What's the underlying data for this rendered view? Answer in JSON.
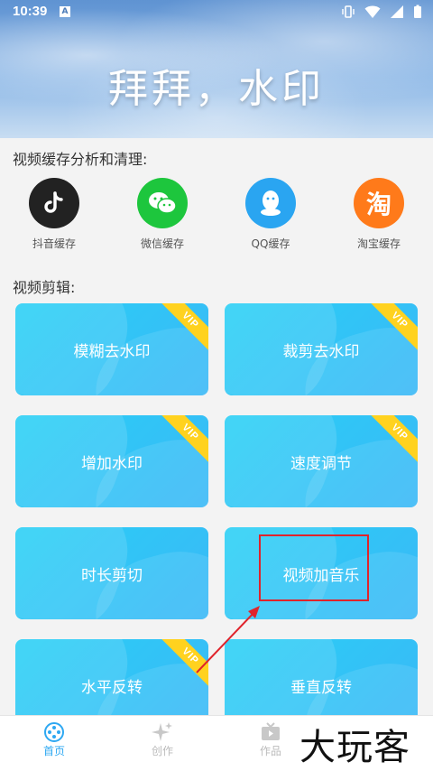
{
  "status_bar": {
    "time": "10:39",
    "app_badge": "A"
  },
  "banner": {
    "title": "拜拜，水印"
  },
  "cache_section": {
    "title": "视频缓存分析和清理:",
    "items": [
      {
        "label": "抖音缓存",
        "icon": "tiktok-icon",
        "color": "#222222"
      },
      {
        "label": "微信缓存",
        "icon": "wechat-icon",
        "color": "#1dc63d"
      },
      {
        "label": "QQ缓存",
        "icon": "qq-icon",
        "color": "#2aa5f1"
      },
      {
        "label": "淘宝缓存",
        "icon": "taobao-icon",
        "color": "#ff7a1a",
        "glyph": "淘"
      }
    ]
  },
  "edit_section": {
    "title": "视频剪辑:",
    "tiles": [
      {
        "label": "模糊去水印",
        "vip": true
      },
      {
        "label": "裁剪去水印",
        "vip": true
      },
      {
        "label": "增加水印",
        "vip": true
      },
      {
        "label": "速度调节",
        "vip": true
      },
      {
        "label": "时长剪切",
        "vip": false
      },
      {
        "label": "视频加音乐",
        "vip": false
      },
      {
        "label": "水平反转",
        "vip": true
      },
      {
        "label": "垂直反转",
        "vip": false
      }
    ],
    "vip_label": "VIP"
  },
  "bottom_nav": {
    "items": [
      {
        "label": "首页",
        "active": true
      },
      {
        "label": "创作",
        "active": false
      },
      {
        "label": "作品",
        "active": false
      }
    ]
  },
  "overlay": {
    "watermark": "大玩客"
  },
  "colors": {
    "accent": "#2ea8f2",
    "tile": "#30c4f6",
    "vip": "#ffd21f",
    "highlight": "#e0232b"
  }
}
